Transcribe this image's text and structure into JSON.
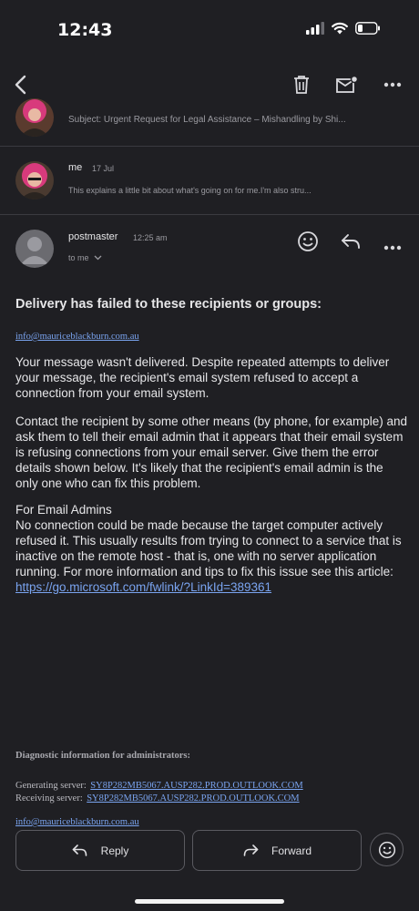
{
  "status_bar": {
    "time": "12:43"
  },
  "thread": {
    "previous_message": {
      "subject": "Subject: Urgent Request for Legal Assistance – Mishandling by Shi..."
    },
    "my_message": {
      "sender": "me",
      "date": "17 Jul",
      "snippet": "This explains a little bit about what's going on for me.I'm also stru..."
    },
    "open_message": {
      "sender": "postmaster",
      "time": "12:25 am",
      "recipient": "to me"
    }
  },
  "email_body": {
    "heading": "Delivery has failed to these recipients or groups:",
    "recipient_email": "info@mauriceblackburn.com.au",
    "paragraph1": "Your message wasn't delivered. Despite repeated attempts to deliver your message, the recipient's email system refused to accept a connection from your email system.",
    "paragraph2": "Contact the recipient by some other means (by phone, for example) and ask them to tell their email admin that it appears that their email system is refusing connections from your email server. Give them the error details shown below. It's likely that the recipient's email admin is the only one who can fix this problem.",
    "admins_title": "For Email Admins",
    "admins_text": "No connection could be made because the target computer actively refused it. This usually results from trying to connect to a service that is inactive on the remote host - that is, one with no server application running. For more information and tips to fix this issue see this article:",
    "article_link": "https://go.microsoft.com/fwlink/?LinkId=389361",
    "diagnostic_title": "Diagnostic information for administrators:",
    "generating_label": "Generating server:",
    "generating_server": "SY8P282MB5067.AUSP282.PROD.OUTLOOK.COM",
    "receiving_label": "Receiving server:",
    "receiving_server": "SY8P282MB5067.AUSP282.PROD.OUTLOOK.COM",
    "footer_email": "info@mauriceblackburn.com.au"
  },
  "actions": {
    "reply_label": "Reply",
    "forward_label": "Forward"
  },
  "colors": {
    "background": "#1f1f23",
    "link": "#7aa4f0",
    "text": "#e6e6e8"
  }
}
